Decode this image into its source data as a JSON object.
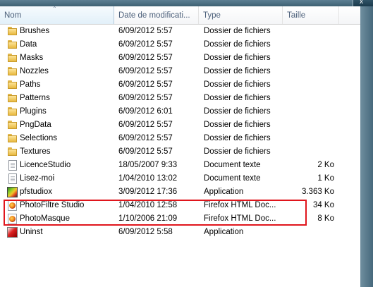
{
  "columns": {
    "name": "Nom",
    "date": "Date de modificati...",
    "type": "Type",
    "size": "Taille"
  },
  "rows": [
    {
      "name": "Brushes",
      "date": "6/09/2012 5:57",
      "type": "Dossier de fichiers",
      "size": "",
      "icon": "folder-icon"
    },
    {
      "name": "Data",
      "date": "6/09/2012 5:57",
      "type": "Dossier de fichiers",
      "size": "",
      "icon": "folder-icon"
    },
    {
      "name": "Masks",
      "date": "6/09/2012 5:57",
      "type": "Dossier de fichiers",
      "size": "",
      "icon": "folder-icon"
    },
    {
      "name": "Nozzles",
      "date": "6/09/2012 5:57",
      "type": "Dossier de fichiers",
      "size": "",
      "icon": "folder-icon"
    },
    {
      "name": "Paths",
      "date": "6/09/2012 5:57",
      "type": "Dossier de fichiers",
      "size": "",
      "icon": "folder-icon"
    },
    {
      "name": "Patterns",
      "date": "6/09/2012 5:57",
      "type": "Dossier de fichiers",
      "size": "",
      "icon": "folder-icon"
    },
    {
      "name": "Plugins",
      "date": "6/09/2012 6:01",
      "type": "Dossier de fichiers",
      "size": "",
      "icon": "folder-icon"
    },
    {
      "name": "PngData",
      "date": "6/09/2012 5:57",
      "type": "Dossier de fichiers",
      "size": "",
      "icon": "folder-icon"
    },
    {
      "name": "Selections",
      "date": "6/09/2012 5:57",
      "type": "Dossier de fichiers",
      "size": "",
      "icon": "folder-icon"
    },
    {
      "name": "Textures",
      "date": "6/09/2012 5:57",
      "type": "Dossier de fichiers",
      "size": "",
      "icon": "folder-icon"
    },
    {
      "name": "LicenceStudio",
      "date": "18/05/2007 9:33",
      "type": "Document texte",
      "size": "2 Ko",
      "icon": "text-document-icon"
    },
    {
      "name": "Lisez-moi",
      "date": "1/04/2010 13:02",
      "type": "Document texte",
      "size": "1 Ko",
      "icon": "text-document-icon"
    },
    {
      "name": "pfstudiox",
      "date": "3/09/2012 17:36",
      "type": "Application",
      "size": "3.363 Ko",
      "icon": "application-icon"
    },
    {
      "name": "PhotoFiltre Studio",
      "date": "1/04/2010 12:58",
      "type": "Firefox HTML Doc...",
      "size": "34 Ko",
      "icon": "firefox-html-icon"
    },
    {
      "name": "PhotoMasque",
      "date": "1/10/2006 21:09",
      "type": "Firefox HTML Doc...",
      "size": "8 Ko",
      "icon": "firefox-html-icon"
    },
    {
      "name": "Uninst",
      "date": "6/09/2012 5:58",
      "type": "Application",
      "size": "",
      "icon": "uninstall-icon"
    }
  ],
  "highlight_color": "#e0151c",
  "close_glyph": "x"
}
